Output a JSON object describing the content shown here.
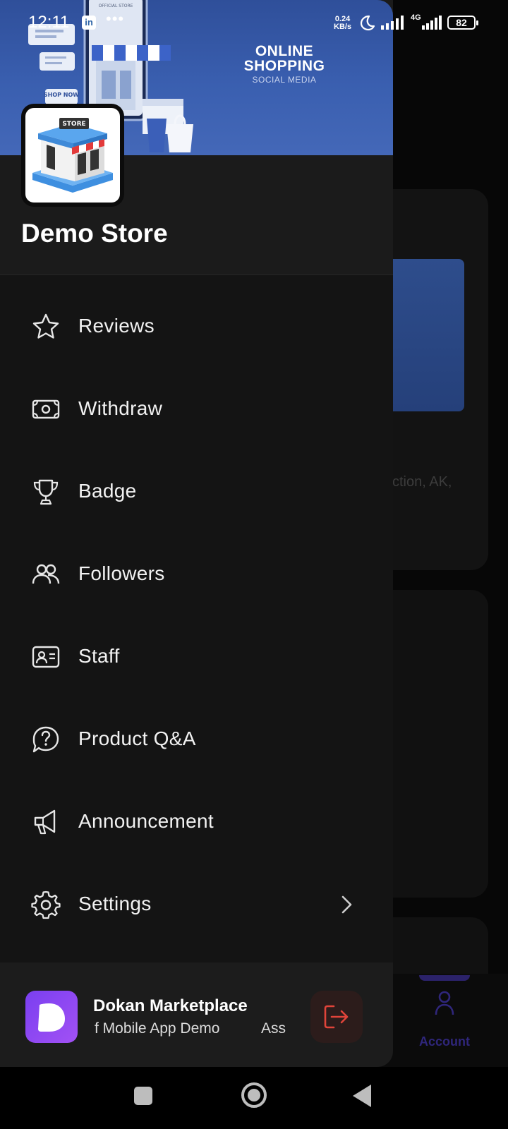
{
  "status_bar": {
    "time": "12:11",
    "linkedin_label": "in",
    "dots": "•••",
    "speed_value": "0.24",
    "speed_unit": "KB/s",
    "network": "4G",
    "battery": "82"
  },
  "background": {
    "address_fragment": "ction, AK,",
    "nav_account_label": "Account",
    "accent_color": "#2f267b"
  },
  "drawer": {
    "cover": {
      "title_line1": "ONLINE",
      "title_line2": "SHOPPING",
      "subtitle": "SOCIAL MEDIA",
      "store_sign": "STORE",
      "shop_now": "SHOP NOW",
      "phone_header": "OFFICIAL STORE"
    },
    "store_name": "Demo Store",
    "menu": [
      {
        "label": "Reviews",
        "icon": "star-icon"
      },
      {
        "label": "Withdraw",
        "icon": "banknote-icon"
      },
      {
        "label": "Badge",
        "icon": "trophy-icon"
      },
      {
        "label": "Followers",
        "icon": "users-icon"
      },
      {
        "label": "Staff",
        "icon": "id-card-icon"
      },
      {
        "label": "Product Q&A",
        "icon": "question-bubble-icon"
      },
      {
        "label": "Announcement",
        "icon": "megaphone-icon"
      },
      {
        "label": "Settings",
        "icon": "gear-icon"
      }
    ],
    "footer": {
      "app_name": "Dokan Marketplace",
      "app_subtitle": "f Mobile App Demo",
      "app_subtitle_tail": "Ass",
      "logout_color": "#e0443a"
    }
  }
}
